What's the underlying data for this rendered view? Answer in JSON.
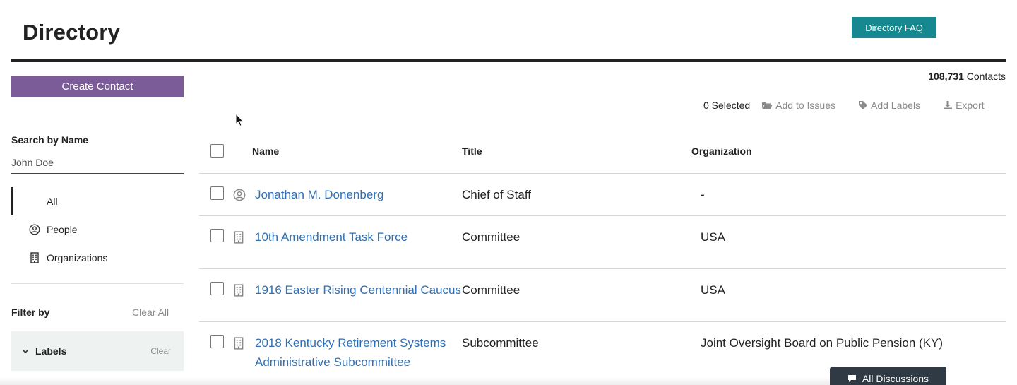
{
  "header": {
    "title": "Directory",
    "faq_label": "Directory FAQ"
  },
  "sidebar": {
    "create_label": "Create Contact",
    "search_label": "Search by Name",
    "search_placeholder": "John Doe",
    "types": [
      {
        "label": "All",
        "icon": "none",
        "active": true
      },
      {
        "label": "People",
        "icon": "person-circle-icon",
        "active": false
      },
      {
        "label": "Organizations",
        "icon": "building-icon",
        "active": false
      }
    ],
    "filter_label": "Filter by",
    "clear_all_label": "Clear All",
    "labels_panel": {
      "label": "Labels",
      "clear_label": "Clear"
    }
  },
  "main": {
    "count_number": "108,731",
    "count_suffix": "Contacts",
    "toolbar": {
      "selected": "0 Selected",
      "add_issues": "Add to Issues",
      "add_labels": "Add Labels",
      "export": "Export"
    },
    "table": {
      "headers": {
        "name": "Name",
        "title": "Title",
        "organization": "Organization"
      },
      "rows": [
        {
          "type": "person-circle-icon",
          "name": "Jonathan M. Donenberg",
          "title": "Chief of Staff",
          "organization": "-"
        },
        {
          "type": "building-icon",
          "name": "10th Amendment Task Force",
          "title": "Committee",
          "organization": "USA"
        },
        {
          "type": "building-icon",
          "name": "1916 Easter Rising Centennial Caucus",
          "title": "Committee",
          "organization": "USA"
        },
        {
          "type": "building-icon",
          "name": "2018 Kentucky Retirement Systems Administrative Subcommittee",
          "title": "Subcommittee",
          "organization": "Joint Oversight Board on Public Pension (KY)"
        }
      ]
    }
  },
  "footer": {
    "discussions_label": "All Discussions"
  },
  "colors": {
    "faq_button": "#15898f",
    "create_button": "#7c5c98",
    "link": "#2f6fb3",
    "discussions_button": "#2f3a45",
    "labels_panel_bg": "#eef3f2"
  }
}
